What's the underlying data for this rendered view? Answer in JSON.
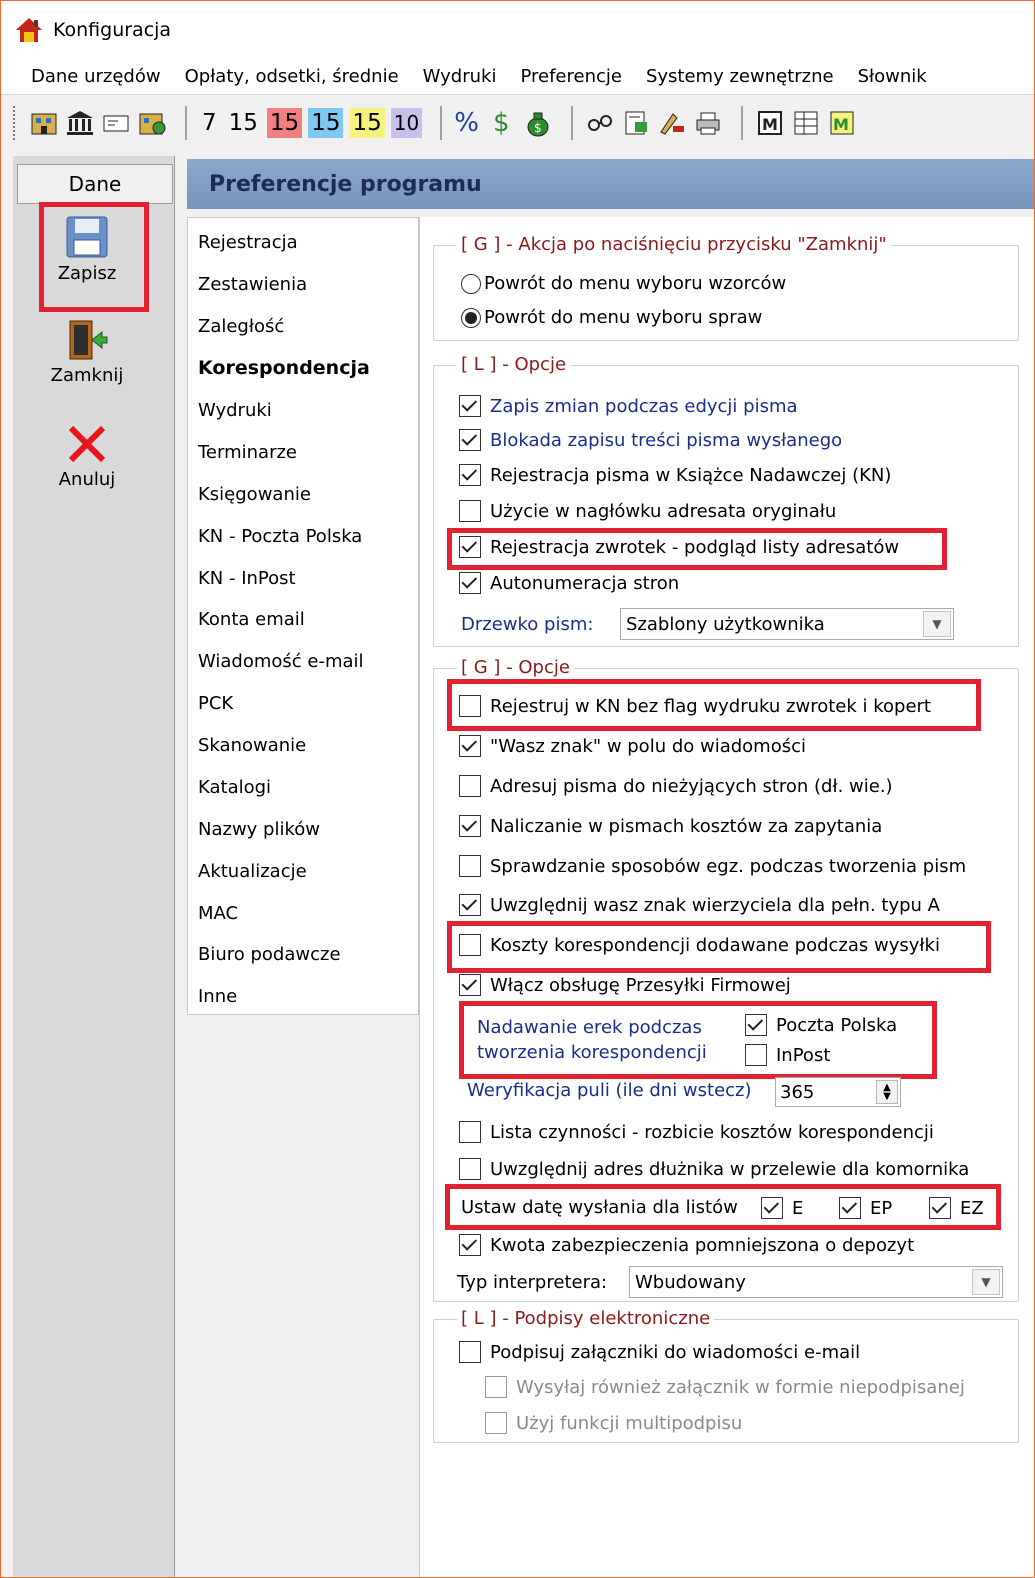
{
  "window": {
    "title": "Konfiguracja"
  },
  "menu": [
    "Dane urzędów",
    "Opłaty, odsetki, średnie",
    "Wydruki",
    "Preferencje",
    "Systemy zewnętrzne",
    "Słownik"
  ],
  "toolbar": {
    "numbers": [
      {
        "text": "7",
        "bg": "transparent"
      },
      {
        "text": "15",
        "bg": "transparent"
      },
      {
        "text": "15",
        "bg": "#f27f7f"
      },
      {
        "text": "15",
        "bg": "#7fc8f2"
      },
      {
        "text": "15",
        "bg": "#f6f27f"
      },
      {
        "text": "10",
        "bg": "#c9c0ee"
      }
    ],
    "percent": "%",
    "dollar": "$"
  },
  "left": {
    "header": "Dane",
    "save": "Zapisz",
    "close": "Zamknij",
    "cancel": "Anuluj"
  },
  "main": {
    "title": "Preferencje programu"
  },
  "tabs": [
    "Rejestracja",
    "Zestawienia",
    "Zaległość",
    "Korespondencja",
    "Wydruki",
    "Terminarze",
    "Księgowanie",
    "KN - Poczta Polska",
    "KN - InPost",
    "Konta email",
    "Wiadomość e-mail",
    "PCK",
    "Skanowanie",
    "Katalogi",
    "Nazwy plików",
    "Aktualizacje",
    "MAC",
    "Biuro podawcze",
    "Inne"
  ],
  "active_tab": "Korespondencja",
  "group1": {
    "legend": "[ G ] - Akcja po naciśnięciu przycisku \"Zamknij\"",
    "options": [
      {
        "label": "Powrót do menu wyboru wzorców",
        "selected": false
      },
      {
        "label": "Powrót do menu wyboru spraw",
        "selected": true
      }
    ]
  },
  "group2": {
    "legend": "[ L ] - Opcje",
    "items": [
      {
        "label": "Zapis zmian podczas edycji pisma",
        "checked": true
      },
      {
        "label": "Blokada zapisu treści pisma wysłanego",
        "checked": true
      },
      {
        "label": "Rejestracja pisma w Książce Nadawczej (KN)",
        "checked": true
      },
      {
        "label": "Użycie w nagłówku adresata oryginału",
        "checked": false
      },
      {
        "label": "Rejestracja zwrotek - podgląd listy adresatów",
        "checked": true
      },
      {
        "label": "Autonumeracja stron",
        "checked": true
      }
    ],
    "tree_label": "Drzewko pism:",
    "tree_value": "Szablony użytkownika"
  },
  "group3": {
    "legend": "[ G ] - Opcje",
    "items": [
      {
        "label": "Rejestruj w KN bez flag wydruku zwrotek i kopert",
        "checked": false
      },
      {
        "label": "\"Wasz znak\" w polu do wiadomości",
        "checked": true
      },
      {
        "label": "Adresuj pisma do nieżyjących stron (dł. wie.)",
        "checked": false
      },
      {
        "label": "Naliczanie w pismach kosztów za zapytania",
        "checked": true
      },
      {
        "label": "Sprawdzanie sposobów egz. podczas tworzenia pism",
        "checked": false
      },
      {
        "label": "Uwzględnij wasz znak wierzyciela dla pełn. typu A",
        "checked": true
      },
      {
        "label": "Koszty korespondencji dodawane podczas wysyłki",
        "checked": false
      },
      {
        "label": "Włącz obsługę Przesyłki Firmowej",
        "checked": true
      }
    ],
    "erek_label_1": "Nadawanie erek podczas",
    "erek_label_2": "tworzenia korespondencji",
    "erek_pp": {
      "label": "Poczta Polska",
      "checked": true
    },
    "erek_inpost": {
      "label": "InPost",
      "checked": false
    },
    "pool_label": "Weryfikacja puli (ile dni wstecz)",
    "pool_value": "365",
    "items2": [
      {
        "label": "Lista czynności - rozbicie kosztów korespondencji",
        "checked": false
      },
      {
        "label": "Uwzględnij adres dłużnika w przelewie dla komornika",
        "checked": false
      }
    ],
    "date_label": "Ustaw datę wysłania dla listów",
    "date_e": {
      "label": "E",
      "checked": true
    },
    "date_ep": {
      "label": "EP",
      "checked": true
    },
    "date_ez": {
      "label": "EZ",
      "checked": true
    },
    "deposit": {
      "label": "Kwota zabezpieczenia pomniejszona o depozyt",
      "checked": true
    },
    "interp_label": "Typ interpretera:",
    "interp_value": "Wbudowany"
  },
  "group4": {
    "legend": "[ L ] - Podpisy elektroniczne",
    "sign": {
      "label": "Podpisuj załączniki do wiadomości e-mail",
      "checked": false
    },
    "send_unsigned": {
      "label": "Wysyłaj również załącznik w formie niepodpisanej",
      "checked": false
    },
    "multi": {
      "label": "Użyj funkcji multipodpisu",
      "checked": false
    }
  },
  "colors": {
    "highlight": "#e22230",
    "header_bg": "#7f9dc2",
    "legend": "#8b1a1a",
    "blue_label": "#1a2d8c"
  }
}
